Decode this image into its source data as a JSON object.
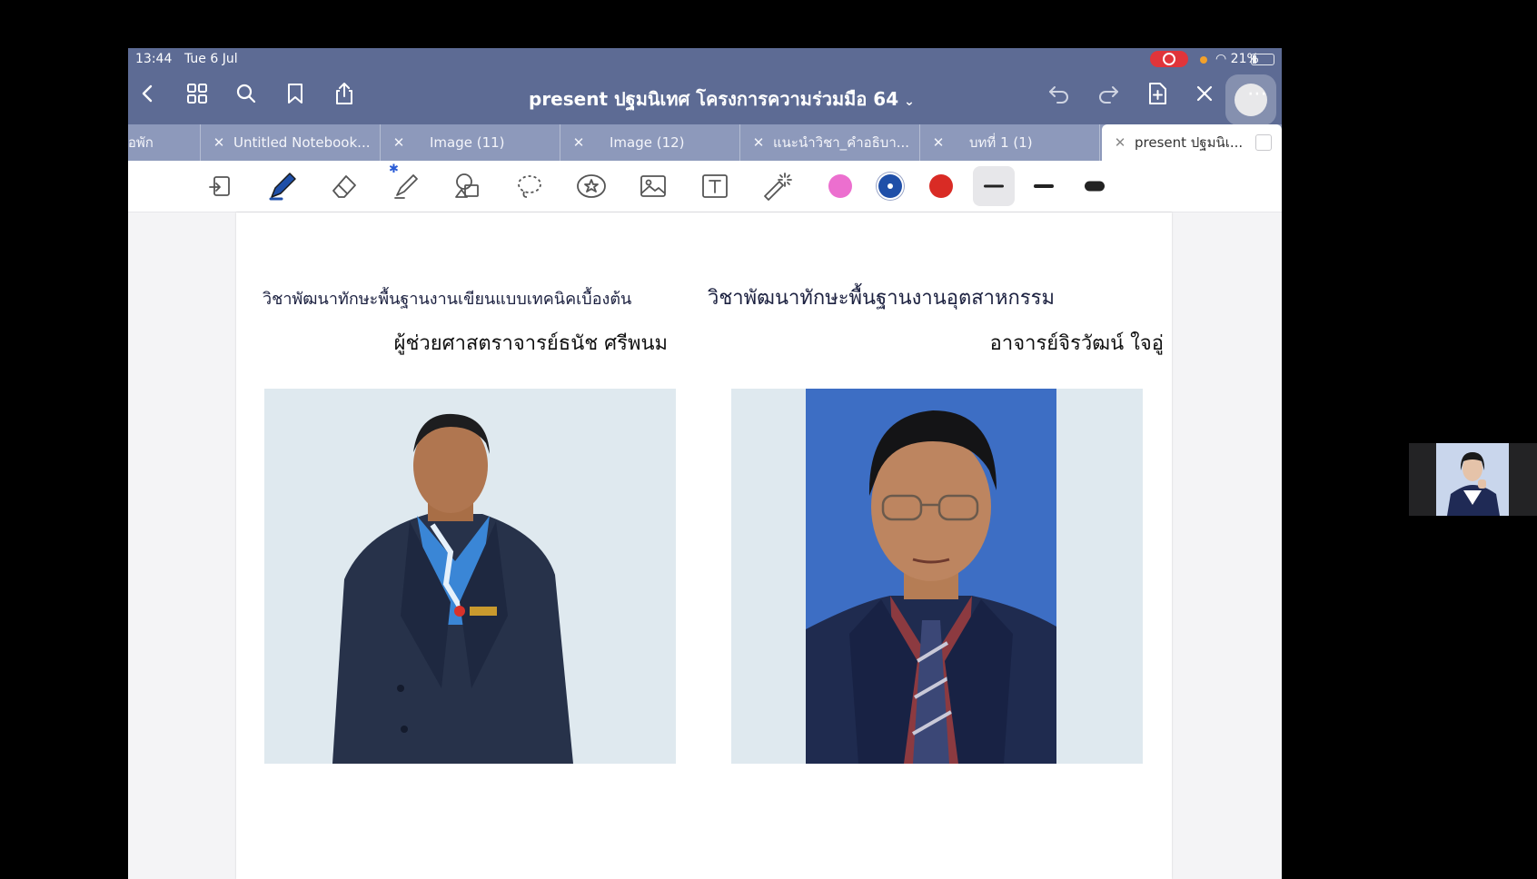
{
  "status_bar": {
    "time": "13:44",
    "date": "Tue 6 Jul",
    "battery": "21%"
  },
  "nav_bar": {
    "title": "present ปฐมนิเทศ โครงการความร่วมมือ 64"
  },
  "tabs": [
    {
      "label": "หอพัก",
      "active": false
    },
    {
      "label": "Untitled Notebook...",
      "active": false
    },
    {
      "label": "Image (11)",
      "active": false
    },
    {
      "label": "Image (12)",
      "active": false
    },
    {
      "label": "แนะนำวิชา_คำอธิบา...",
      "active": false
    },
    {
      "label": "บทที่ 1 (1)",
      "active": false
    },
    {
      "label": "present ปฐมนิเ...",
      "active": true
    }
  ],
  "toolbar": {
    "colors": [
      "#ec6fcf",
      "#1f4fa8",
      "#d92b25"
    ],
    "selected_color": "#1f4fa8",
    "stroke_sizes": [
      "thin",
      "medium",
      "thick"
    ],
    "selected_stroke": "thin"
  },
  "page": {
    "left": {
      "subject": "วิชาพัฒนาทักษะพื้นฐานงานเขียนแบบเทคนิคเบื้องต้น",
      "teacher": "ผู้ช่วยศาสตราจารย์ธนัช ศรีพนม"
    },
    "right": {
      "subject": "วิชาพัฒนาทักษะพื้นฐานงานอุตสาหกรรม",
      "teacher": "อาจารย์จิรวัฒน์ ใจอู่"
    }
  },
  "colors": {
    "header_bg": "#5d6b94",
    "tab_bar_bg": "#8d99bb",
    "recording": "#e0353a"
  }
}
